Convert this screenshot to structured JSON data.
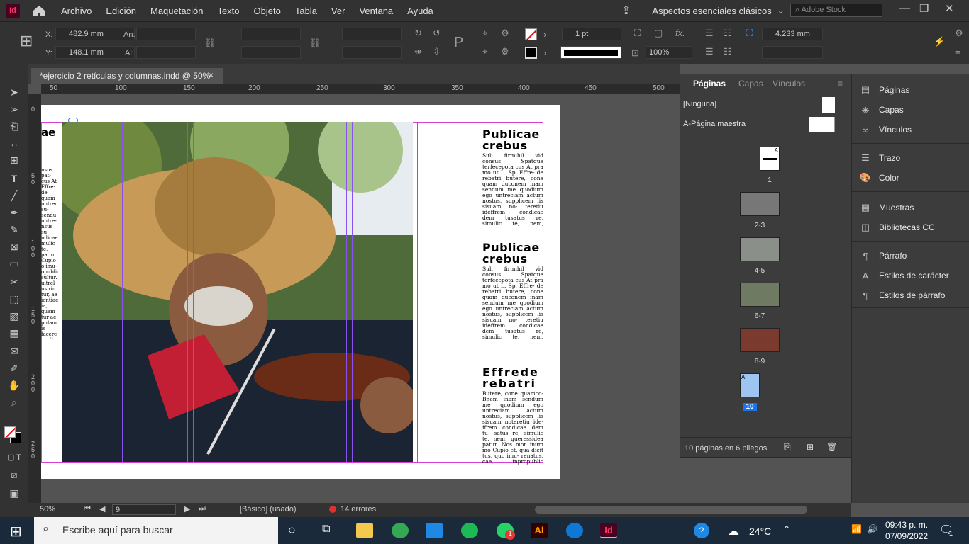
{
  "app": {
    "name": "Id",
    "menus": [
      "Archivo",
      "Edición",
      "Maquetación",
      "Texto",
      "Objeto",
      "Tabla",
      "Ver",
      "Ventana",
      "Ayuda"
    ],
    "workspace": "Aspectos esenciales clásicos",
    "stock_search_placeholder": "Adobe Stock"
  },
  "control": {
    "x_label": "X:",
    "x_value": "482.9 mm",
    "y_label": "Y:",
    "y_value": "148.1 mm",
    "w_label": "An:",
    "h_label": "Al:",
    "stroke_weight": "1 pt",
    "zoom_pct": "100%",
    "spacing": "4.233 mm"
  },
  "document": {
    "tab_title": "*ejercicio 2 retículas y columnas.indd @ 50%",
    "close": "×"
  },
  "ruler": {
    "labels": [
      "50",
      "100",
      "150",
      "200",
      "250",
      "300",
      "350",
      "400",
      "450",
      "500"
    ],
    "v_labels": [
      "0",
      "5\n0",
      "1\n0\n0",
      "1\n5\n0",
      "2\n0\n0",
      "2\n5\n0"
    ]
  },
  "text_left": {
    "heading": "ae"
  },
  "text_blocks": [
    {
      "heading": "Publicae crebus",
      "body": "Suli firmihil vid consus Spatque terfecepota cus At pra mo ut L. Sp. Effre- de rebatri butere, cone quam duconem inam sendum me quodium ego untreciam actum nostus, supplicem lis sisuam no- teretiu ideffrem condicae dem tusatus re, simulic te, nem, queressidea patur. Nos mor inum mo Cupi et, qua dicit tus, quo imu-"
    },
    {
      "heading": "Publicae crebus",
      "body": "Suli firmihil vid consus Spatque terfecepota cus At pra mo ut L. Sp. Effre- de rebatri butere, cone quam duconem inam sendum me quodium ego untreciam actum nostus, supplicem lis sisuam no- teretiu ideffrem condicae dem tusatus re, simulic te, nem, queressidea patur. Nos mor inum mo Cupi et, qua dicit tus, quo imu-"
    },
    {
      "heading": "Effrede rebatri",
      "body": "Butere, cone quamco- Bnem inam sendum me quodium ego untreciam actum nostus, supplicem lis sisuam noteretiu ide- ffrem condicae dem tu- satus re, simulic te, nem, queressidea patur. Nos mor inum mo Cupio et, qua dicit tus, quo imu- renatus, cae, inpropublic manum ute tam sultur. Romneme estilib ustrel"
    }
  ],
  "status": {
    "zoom": "50%",
    "page": "9",
    "style": "[Básico] (usado)",
    "errors": "14 errores"
  },
  "pages_panel": {
    "tabs": [
      "Páginas",
      "Capas",
      "Vínculos"
    ],
    "none": "[Ninguna]",
    "master": "A-Página maestra",
    "page_labels": [
      "1",
      "2-3",
      "4-5",
      "6-7",
      "8-9",
      "10"
    ],
    "summary": "10 páginas en 6 pliegos"
  },
  "side_panels": [
    "Páginas",
    "Capas",
    "Vínculos",
    "Trazo",
    "Color",
    "Muestras",
    "Bibliotecas CC",
    "Párrafo",
    "Estilos de carácter",
    "Estilos de párrafo"
  ],
  "taskbar": {
    "search_placeholder": "Escribe aquí para buscar",
    "temp": "24°C",
    "time": "09:43 p. m.",
    "date": "07/09/2022",
    "notif": "1",
    "whatsapp_badge": "1"
  },
  "colors": {
    "accent": "#ff3366",
    "margin": "#d63fd6",
    "column": "#8a52f0"
  }
}
